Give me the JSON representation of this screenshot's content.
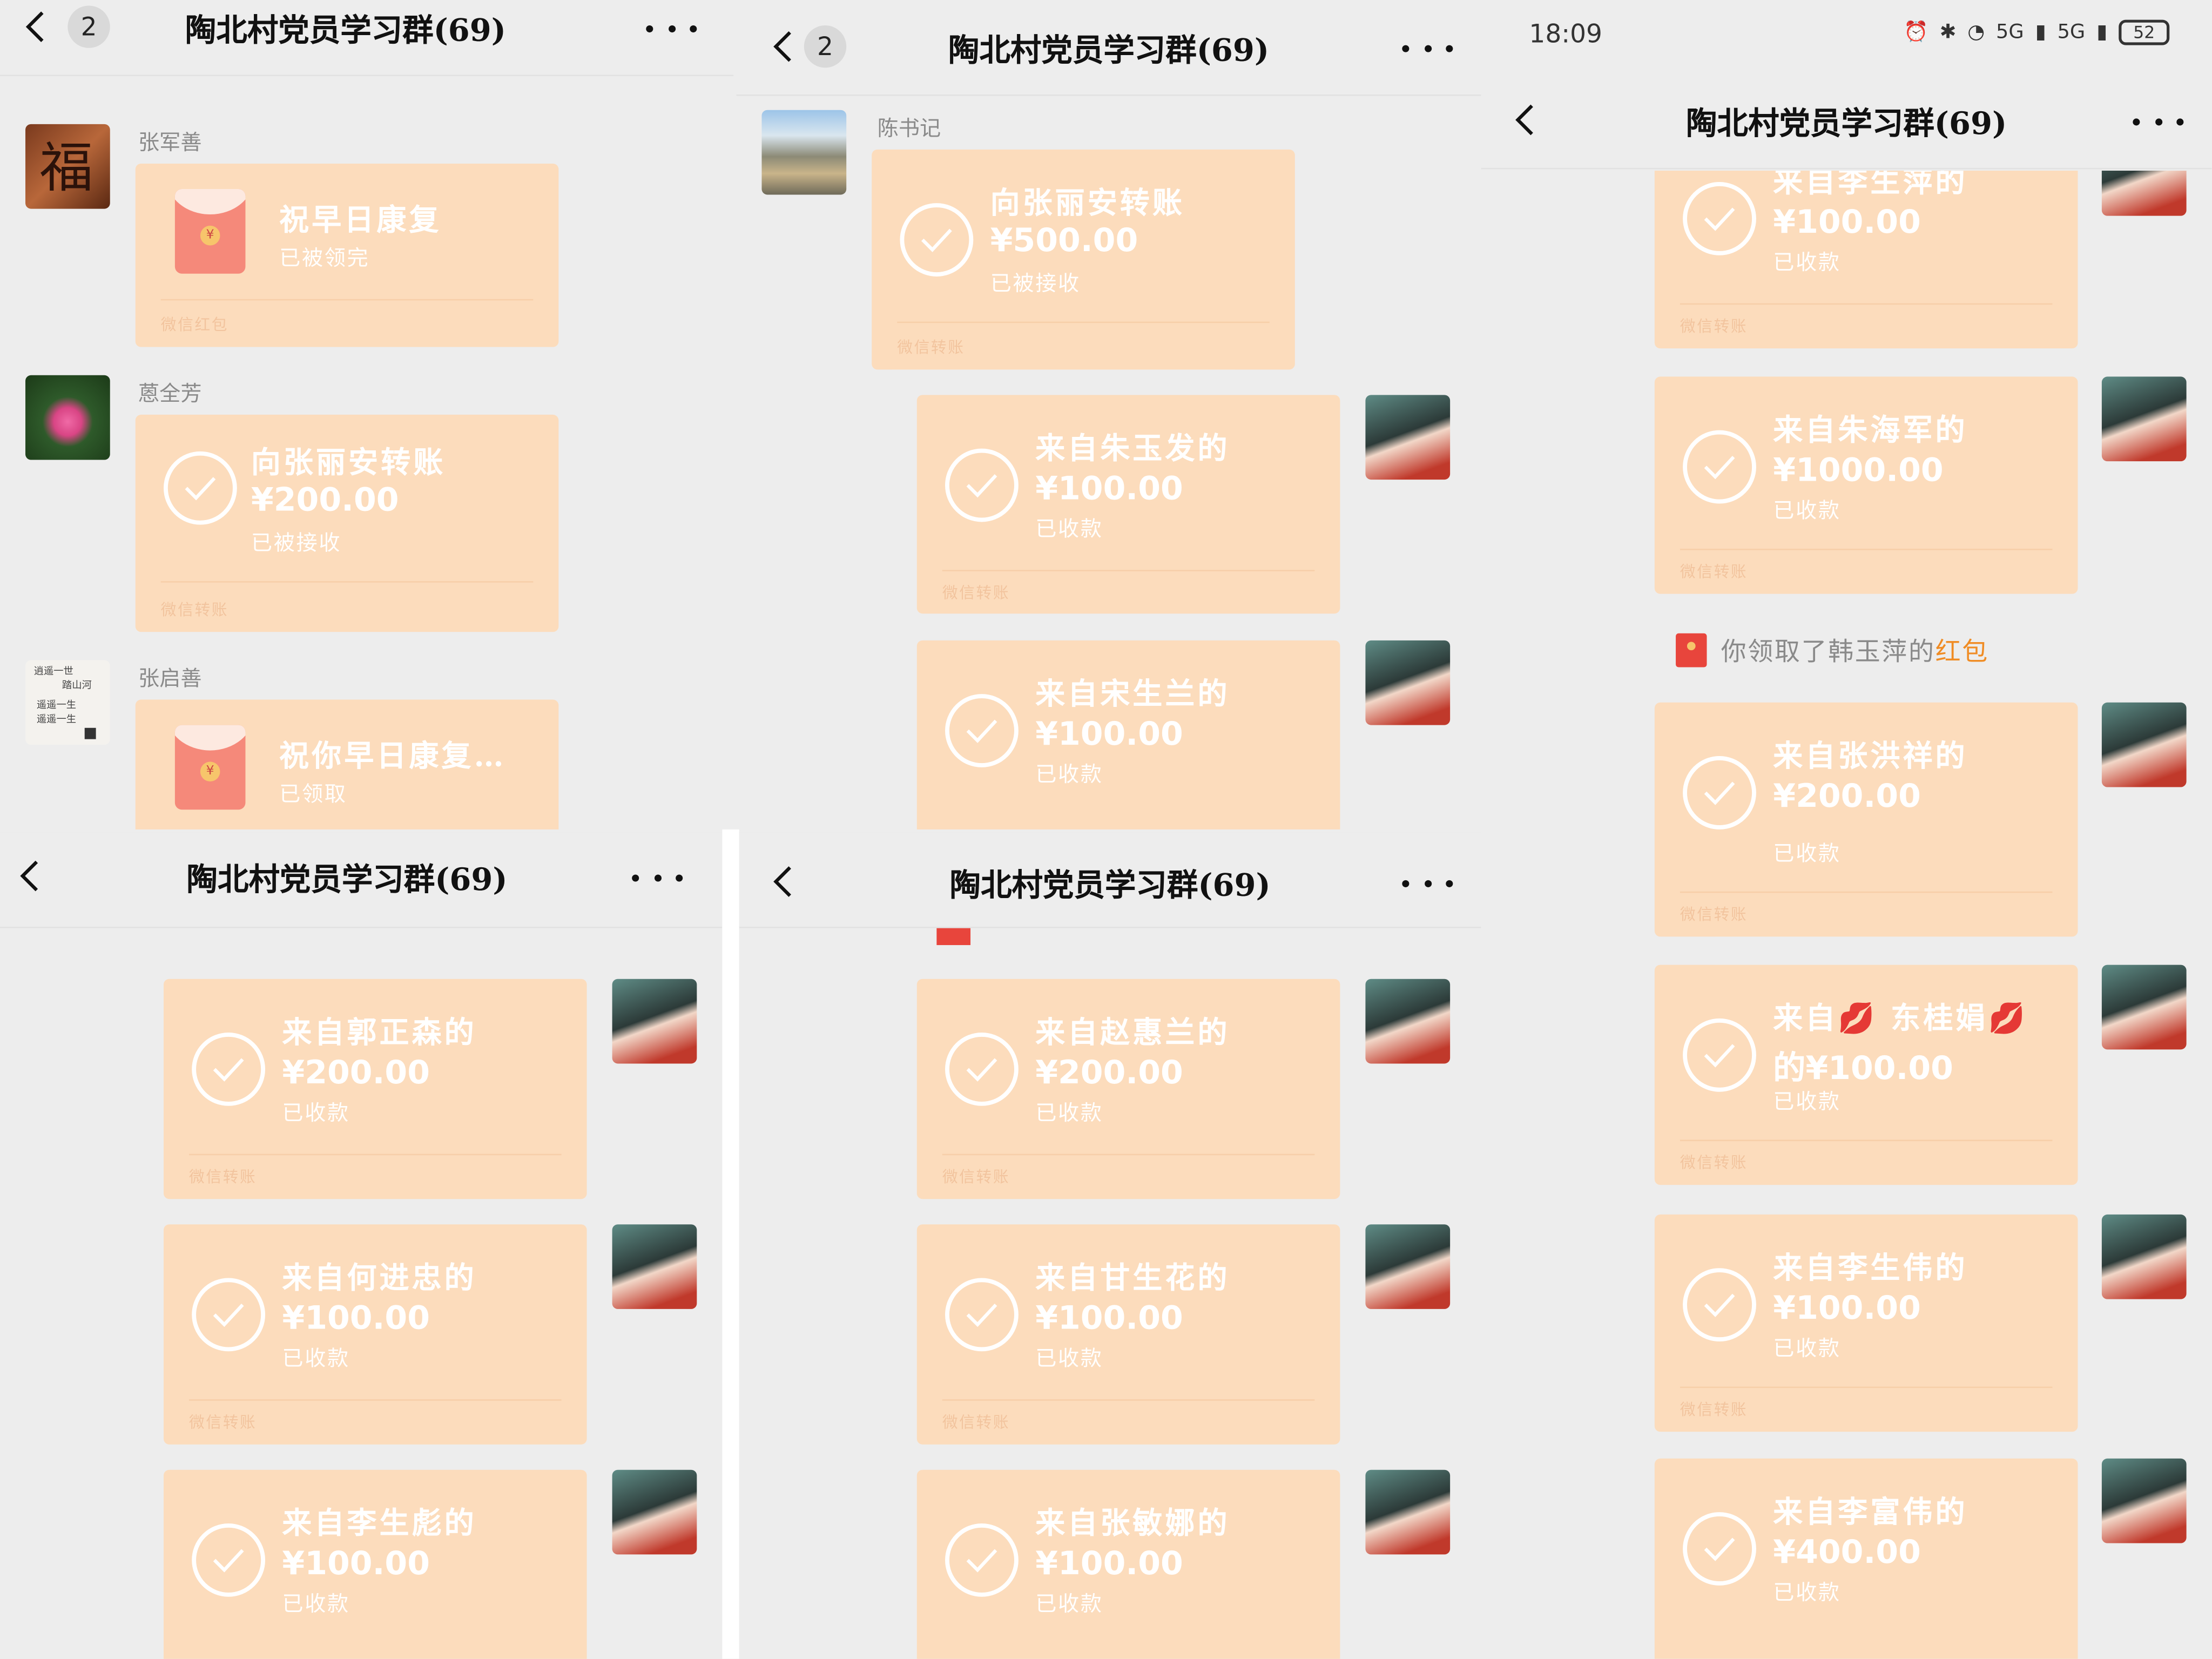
{
  "group_title": "陶北村党员学习群(69)",
  "unread_badge": "2",
  "status_bar": {
    "time": "18:09",
    "battery": "52",
    "net1": "5G",
    "net2": "5G"
  },
  "transfer_label": "微信转账",
  "redpacket_label": "微信红包",
  "p1": {
    "m1": {
      "sender": "张军善",
      "text": "祝早日康复",
      "status": "已被领完"
    },
    "m2": {
      "sender": "蒽全芳",
      "text": "向张丽安转账",
      "amount": "¥200.00",
      "status": "已被接收"
    },
    "m3": {
      "sender": "张启善",
      "text": "祝你早日康复…",
      "status": "已领取"
    }
  },
  "p2": {
    "m1": {
      "sender": "陈书记",
      "text": "向张丽安转账",
      "amount": "¥500.00",
      "status": "已被接收"
    },
    "m2": {
      "text": "来自朱玉发的",
      "amount": "¥100.00",
      "status": "已收款"
    },
    "m3": {
      "text": "来自宋生兰的",
      "amount": "¥100.00",
      "status": "已收款"
    }
  },
  "p3": {
    "m0": {
      "text": "来自李生萍的",
      "amount": "¥100.00",
      "status": "已收款"
    },
    "m1": {
      "text": "来自朱海军的",
      "amount": "¥1000.00",
      "status": "已收款"
    },
    "notice": {
      "pre": "你领取了韩玉萍的",
      "hl": "红包"
    },
    "m2": {
      "text": "来自张洪祥的",
      "amount": "¥200.00",
      "status": "已收款"
    },
    "m3": {
      "text": "来自💋 东桂娟💋",
      "amount": "的¥100.00",
      "status": "已收款"
    },
    "m4": {
      "text": "来自李生伟的",
      "amount": "¥100.00",
      "status": "已收款"
    },
    "m5": {
      "text": "来自李富伟的",
      "amount": "¥400.00",
      "status": "已收款"
    }
  },
  "p4": {
    "m1": {
      "text": "来自郭正森的",
      "amount": "¥200.00",
      "status": "已收款"
    },
    "m2": {
      "text": "来自何进忠的",
      "amount": "¥100.00",
      "status": "已收款"
    },
    "m3": {
      "text": "来自李生彪的",
      "amount": "¥100.00",
      "status": "已收款"
    }
  },
  "p5": {
    "m1": {
      "text": "来自赵惠兰的",
      "amount": "¥200.00",
      "status": "已收款"
    },
    "m2": {
      "text": "来自甘生花的",
      "amount": "¥100.00",
      "status": "已收款"
    },
    "m3": {
      "text": "来自张敏娜的",
      "amount": "¥100.00",
      "status": "已收款"
    }
  }
}
